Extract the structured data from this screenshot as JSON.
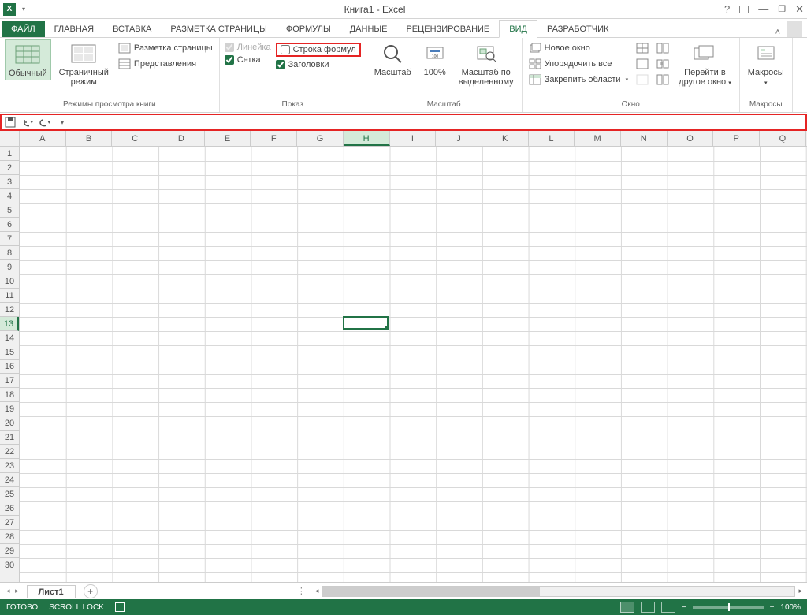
{
  "title": "Книга1 - Excel",
  "tabs": [
    "ФАЙЛ",
    "ГЛАВНАЯ",
    "ВСТАВКА",
    "РАЗМЕТКА СТРАНИЦЫ",
    "ФОРМУЛЫ",
    "ДАННЫЕ",
    "РЕЦЕНЗИРОВАНИЕ",
    "ВИД",
    "РАЗРАБОТЧИК"
  ],
  "activeTab": "ВИД",
  "ribbon": {
    "views": {
      "normal": "Обычный",
      "pagebreak": "Страничный\nрежим",
      "pagelayout": "Разметка страницы",
      "custom": "Представления",
      "group": "Режимы просмотра книги"
    },
    "show": {
      "ruler": "Линейка",
      "formulaBar": "Строка формул",
      "gridlines": "Сетка",
      "headings": "Заголовки",
      "group": "Показ"
    },
    "zoom": {
      "zoom": "Масштаб",
      "p100": "100%",
      "toSelection": "Масштаб по\nвыделенному",
      "group": "Масштаб"
    },
    "window": {
      "newWindow": "Новое окно",
      "arrange": "Упорядочить все",
      "freeze": "Закрепить области",
      "switch": "Перейти в\nдругое окно",
      "group": "Окно"
    },
    "macros": {
      "macros": "Макросы",
      "group": "Макросы"
    }
  },
  "columns": [
    "A",
    "B",
    "C",
    "D",
    "E",
    "F",
    "G",
    "H",
    "I",
    "J",
    "K",
    "L",
    "M",
    "N",
    "O",
    "P",
    "Q"
  ],
  "rows": [
    1,
    2,
    3,
    4,
    5,
    6,
    7,
    8,
    9,
    10,
    11,
    12,
    13,
    14,
    15,
    16,
    17,
    18,
    19,
    20,
    21,
    22,
    23,
    24,
    25,
    26,
    27,
    28,
    29,
    30
  ],
  "activeCol": "H",
  "activeRow": 13,
  "sheet": "Лист1",
  "status": {
    "ready": "ГОТОВО",
    "scroll": "SCROLL LOCK",
    "zoom": "100%"
  }
}
